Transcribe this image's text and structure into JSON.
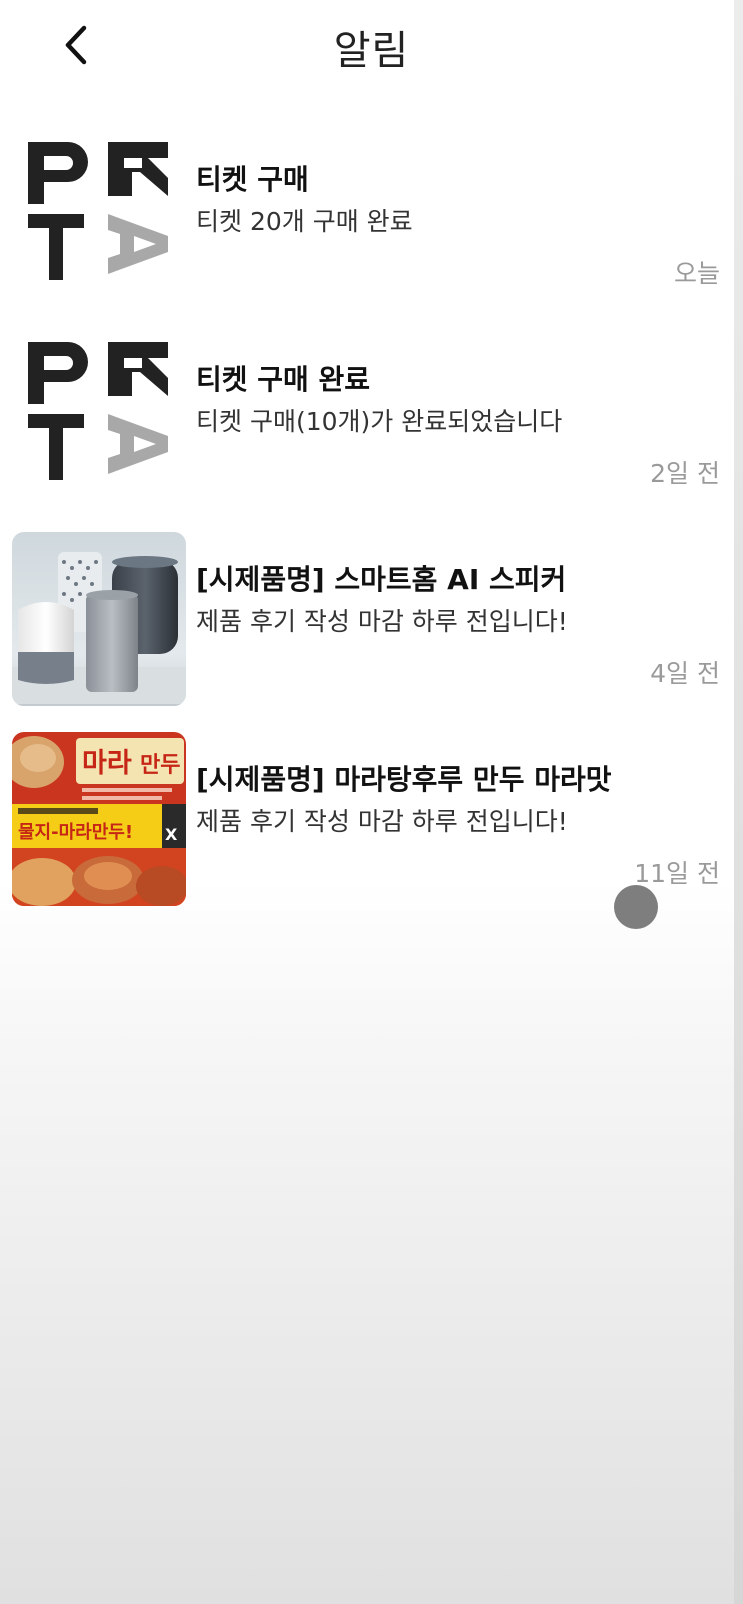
{
  "header": {
    "title": "알림",
    "back_icon": "chevron-left-icon"
  },
  "notifications": [
    {
      "title": "티켓 구매",
      "body": "티켓 20개 구매 완료",
      "time": "오늘",
      "thumbnail": "ptar-logo",
      "thumbnail_text": "PTAR"
    },
    {
      "title": "티켓 구매 완료",
      "body": "티켓 구매(10개)가 완료되었습니다",
      "time": "2일 전",
      "thumbnail": "ptar-logo",
      "thumbnail_text": "PTAR"
    },
    {
      "title": "[시제품명] 스마트홈 AI 스피커",
      "body": "제품 후기 작성 마감 하루 전입니다!",
      "time": "4일 전",
      "thumbnail": "smart-speaker-photo"
    },
    {
      "title": "[시제품명] 마라탕후루 만두 마라맛",
      "body": "제품 후기 작성 마감 하루 전입니다!",
      "time": "11일 전",
      "thumbnail": "mala-dumpling-package-photo",
      "thumbnail_text": [
        "마라 만두",
        "물지-마라만두!"
      ]
    }
  ],
  "colors": {
    "logo_dark": "#222222",
    "logo_gray": "#a8a8a8",
    "time_text": "#9a9a9a",
    "package_red": "#d8311f",
    "package_yellow": "#f5cc16"
  }
}
